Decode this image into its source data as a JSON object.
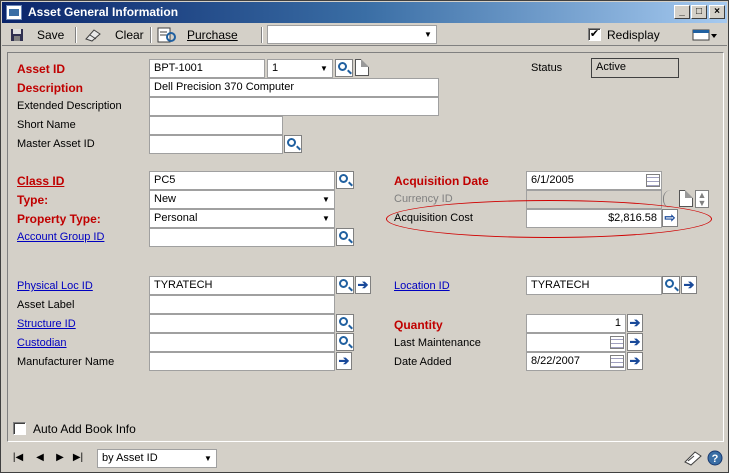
{
  "window": {
    "title": "Asset General Information"
  },
  "toolbar": {
    "save": "Save",
    "clear": "Clear",
    "purchase": "Purchase",
    "combo_value": "",
    "redisplay": "Redisplay",
    "redisplay_checked": true
  },
  "form": {
    "asset_id": {
      "label": "Asset ID",
      "value": "BPT-1001",
      "suffix": "1"
    },
    "status": {
      "label": "Status",
      "value": "Active"
    },
    "description": {
      "label": "Description",
      "value": "Dell Precision 370 Computer"
    },
    "extended_description": {
      "label": "Extended Description",
      "value": ""
    },
    "short_name": {
      "label": "Short Name",
      "value": ""
    },
    "master_asset_id": {
      "label": "Master Asset ID",
      "value": ""
    },
    "class_id": {
      "label": "Class ID",
      "value": "PC5"
    },
    "type": {
      "label": "Type:",
      "value": "New"
    },
    "property_type": {
      "label": "Property Type:",
      "value": "Personal"
    },
    "account_group_id": {
      "label": "Account Group ID",
      "value": ""
    },
    "acquisition_date": {
      "label": "Acquisition Date",
      "value": "6/1/2005"
    },
    "currency_id": {
      "label": "Currency ID",
      "value": ""
    },
    "acquisition_cost": {
      "label": "Acquisition Cost",
      "value": "$2,816.58"
    },
    "physical_loc_id": {
      "label": "Physical Loc ID",
      "value": "TYRATECH"
    },
    "asset_label": {
      "label": "Asset Label",
      "value": ""
    },
    "structure_id": {
      "label": "Structure ID",
      "value": ""
    },
    "custodian": {
      "label": "Custodian",
      "value": ""
    },
    "manufacturer_name": {
      "label": "Manufacturer Name",
      "value": ""
    },
    "location_id": {
      "label": "Location ID",
      "value": "TYRATECH"
    },
    "quantity": {
      "label": "Quantity",
      "value": "1"
    },
    "last_maintenance": {
      "label": "Last Maintenance",
      "value": ""
    },
    "date_added": {
      "label": "Date Added",
      "value": "8/22/2007"
    },
    "auto_add_book_info": {
      "label": "Auto Add Book Info",
      "checked": false
    }
  },
  "statusbar": {
    "sort_by": "by Asset ID"
  }
}
